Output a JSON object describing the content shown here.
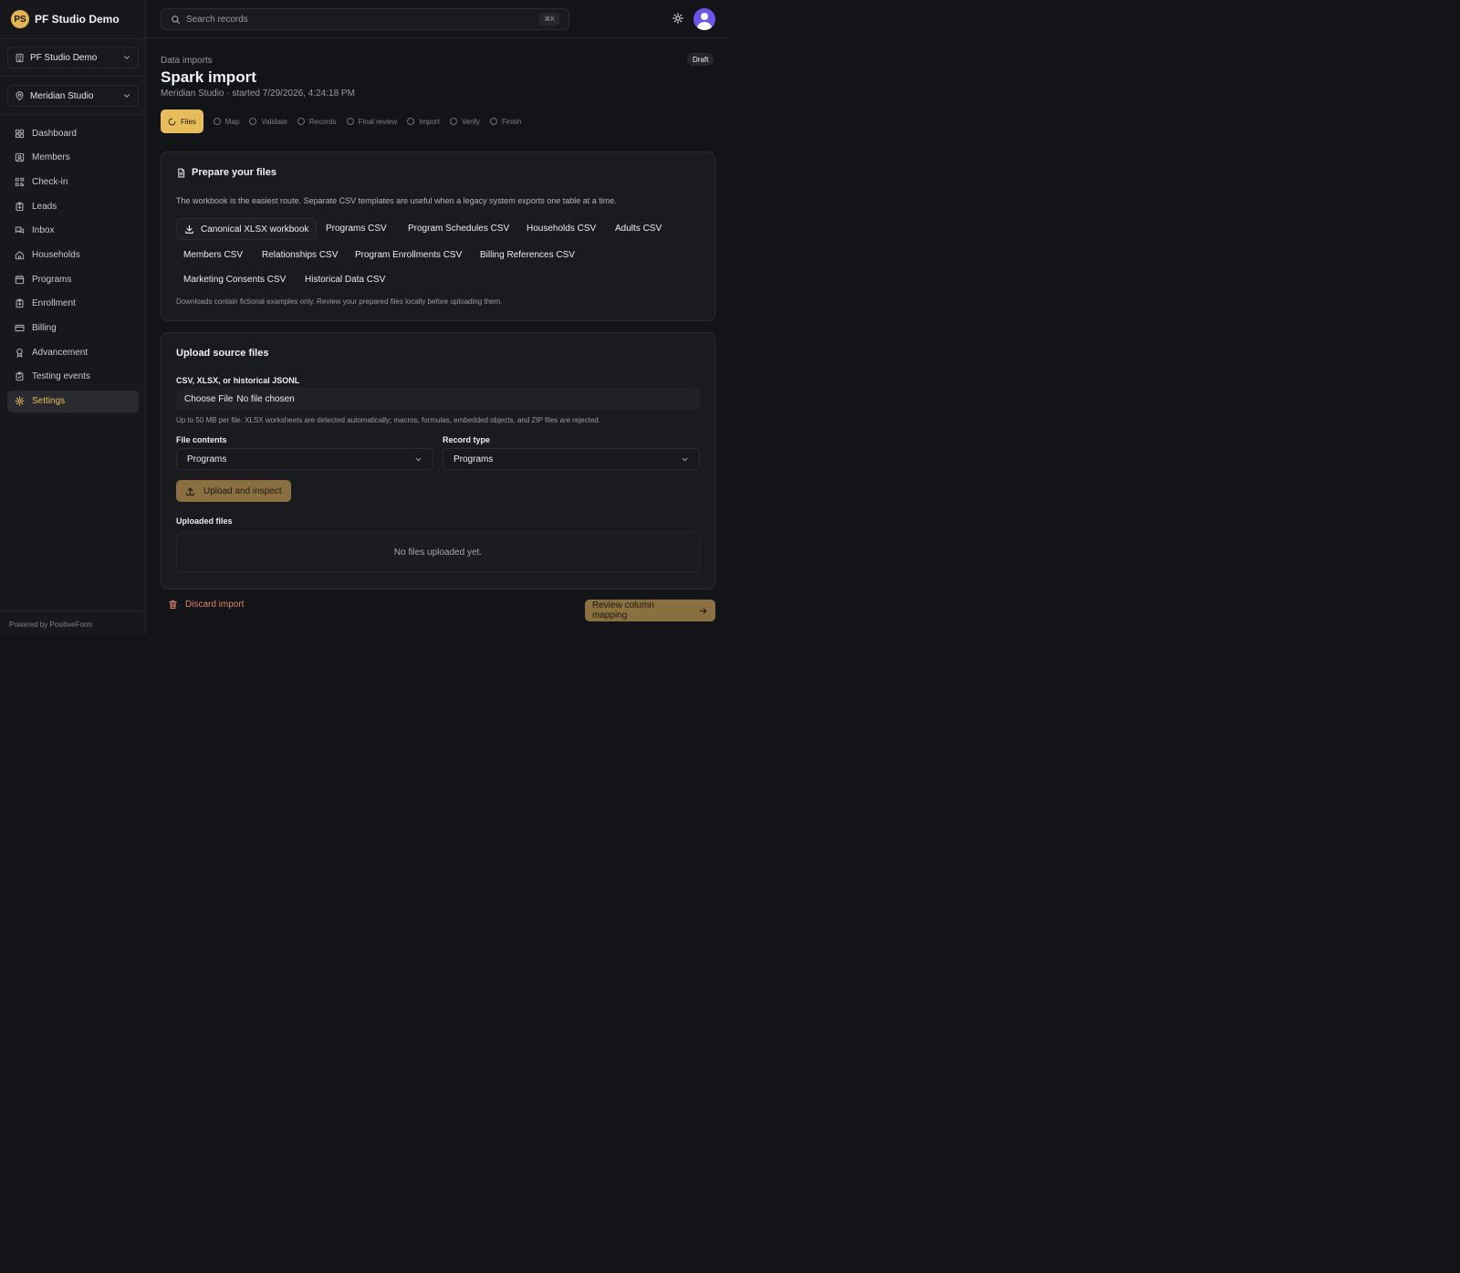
{
  "brand": {
    "initials": "PS",
    "name": "PF Studio Demo"
  },
  "org_switcher": {
    "value": "PF Studio Demo"
  },
  "location_switcher": {
    "value": "Meridian Studio"
  },
  "sidebar": {
    "items": [
      {
        "label": "Dashboard",
        "icon": "dashboard-icon"
      },
      {
        "label": "Members",
        "icon": "members-icon"
      },
      {
        "label": "Check-in",
        "icon": "qr-icon"
      },
      {
        "label": "Leads",
        "icon": "clipboard-icon"
      },
      {
        "label": "Inbox",
        "icon": "chat-icon"
      },
      {
        "label": "Households",
        "icon": "home-icon"
      },
      {
        "label": "Programs",
        "icon": "calendar-icon"
      },
      {
        "label": "Enrollment",
        "icon": "clipboard-icon"
      },
      {
        "label": "Billing",
        "icon": "card-icon"
      },
      {
        "label": "Advancement",
        "icon": "award-icon"
      },
      {
        "label": "Testing events",
        "icon": "clipboard-check-icon"
      },
      {
        "label": "Settings",
        "icon": "gear-icon",
        "active": true
      }
    ],
    "footer": "Powered by PositiveForm"
  },
  "topbar": {
    "search_placeholder": "Search records",
    "shortcut": "⌘K"
  },
  "page": {
    "breadcrumb": "Data imports",
    "title": "Spark import",
    "subtitle": "Meridian Studio · started 7/29/2026, 4:24:18 PM",
    "status_badge": "Draft"
  },
  "steps": [
    {
      "label": "Files",
      "active": true
    },
    {
      "label": "Map"
    },
    {
      "label": "Validate"
    },
    {
      "label": "Records"
    },
    {
      "label": "Final review"
    },
    {
      "label": "Import"
    },
    {
      "label": "Verify"
    },
    {
      "label": "Finish"
    }
  ],
  "prepare": {
    "title": "Prepare your files",
    "description": "The workbook is the easiest route. Separate CSV templates are useful when a legacy system exports one table at a time.",
    "workbook_label": "Canonical XLSX workbook",
    "templates": [
      "Programs CSV",
      "Program Schedules CSV",
      "Households CSV",
      "Adults CSV",
      "Members CSV",
      "Relationships CSV",
      "Program Enrollments CSV",
      "Billing References CSV",
      "Marketing Consents CSV",
      "Historical Data CSV"
    ],
    "note": "Downloads contain fictional examples only. Review your prepared files locally before uploading them."
  },
  "upload": {
    "title": "Upload source files",
    "file_label": "CSV, XLSX, or historical JSONL",
    "file_button": "Choose File",
    "file_status": "No file chosen",
    "hint": "Up to 50 MB per file. XLSX worksheets are detected automatically; macros, formulas, embedded objects, and ZIP files are rejected.",
    "contents_label": "File contents",
    "contents_value": "Programs",
    "record_type_label": "Record type",
    "record_type_value": "Programs",
    "upload_button": "Upload and inspect",
    "uploaded_label": "Uploaded files",
    "empty_text": "No files uploaded yet."
  },
  "footer_actions": {
    "discard": "Discard import",
    "next": "Review column mapping"
  },
  "colors": {
    "accent": "#e7bc5a",
    "accent_muted": "#8a7040",
    "danger": "#e0826a",
    "avatar": "#6d56e8",
    "background": "#131418"
  }
}
